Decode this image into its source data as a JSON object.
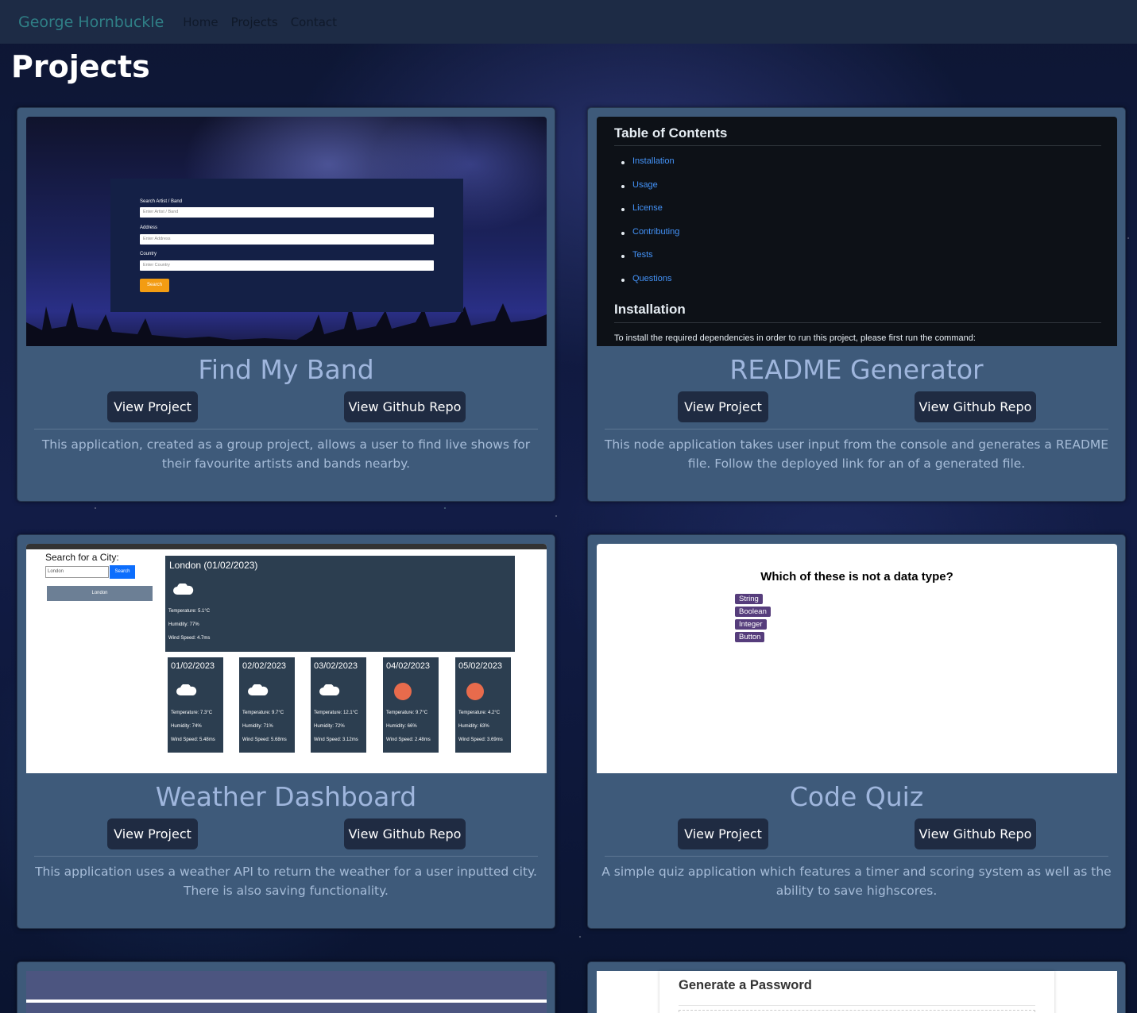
{
  "navbar": {
    "brand": "George Hornbuckle",
    "links": [
      "Home",
      "Projects",
      "Contact"
    ]
  },
  "page": {
    "title": "Projects"
  },
  "projects": [
    {
      "title": "Find My Band",
      "view_project": "View Project",
      "view_repo": "View Github Repo",
      "description": "This application, created as a group project, allows a user to find live shows for their favourite artists and bands nearby.",
      "preview": {
        "label_artist": "Search Artist / Band",
        "placeholder_artist": "Enter Artist / Band",
        "label_address": "Address",
        "placeholder_address": "Enter Address",
        "label_country": "Country",
        "placeholder_country": "Enter Country",
        "search_button": "Search"
      }
    },
    {
      "title": "README Generator",
      "view_project": "View Project",
      "view_repo": "View Github Repo",
      "description": "This node application takes user input from the console and generates a README file. Follow the deployed link for an of a generated file.",
      "preview": {
        "toc_heading": "Table of Contents",
        "toc_items": [
          "Installation",
          "Usage",
          "License",
          "Contributing",
          "Tests",
          "Questions"
        ],
        "install_heading": "Installation",
        "install_text": "To install the required dependencies in order to run this project, please first run the command:"
      }
    },
    {
      "title": "Weather Dashboard",
      "view_project": "View Project",
      "view_repo": "View Github Repo",
      "description": "This application uses a weather API to return the weather for a user inputted city. There is also saving functionality.",
      "preview": {
        "search_label": "Search for a City:",
        "input_value": "London",
        "search_button": "Search",
        "history_item": "London",
        "today_title": "London (01/02/2023)",
        "today_temp": "Temperature: 5.1°C",
        "today_humidity": "Humidity: 77%",
        "today_wind": "Wind Speed: 4.7ms",
        "forecast": [
          {
            "date": "01/02/2023",
            "icon": "cloud-icon",
            "temp": "Temperature: 7.3°C",
            "humidity": "Humidity: 74%",
            "wind": "Wind Speed: 5.48ms"
          },
          {
            "date": "02/02/2023",
            "icon": "cloud-icon",
            "temp": "Temperature: 9.7°C",
            "humidity": "Humidity: 71%",
            "wind": "Wind Speed: 5.68ms"
          },
          {
            "date": "03/02/2023",
            "icon": "cloud-icon",
            "temp": "Temperature: 12.1°C",
            "humidity": "Humidity: 72%",
            "wind": "Wind Speed: 3.12ms"
          },
          {
            "date": "04/02/2023",
            "icon": "sun-icon",
            "temp": "Temperature: 9.7°C",
            "humidity": "Humidity: 66%",
            "wind": "Wind Speed: 2.48ms"
          },
          {
            "date": "05/02/2023",
            "icon": "sun-icon",
            "temp": "Temperature: 4.2°C",
            "humidity": "Humidity: 63%",
            "wind": "Wind Speed: 3.69ms"
          }
        ]
      }
    },
    {
      "title": "Code Quiz",
      "view_project": "View Project",
      "view_repo": "View Github Repo",
      "description": "A simple quiz application which features a timer and scoring system as well as the ability to save highscores.",
      "preview": {
        "question": "Which of these is not a data type?",
        "options": [
          "String",
          "Boolean",
          "Integer",
          "Button"
        ]
      }
    }
  ],
  "partial_cards": {
    "password_title": "Generate a Password"
  },
  "colors": {
    "navbar": "#1d2b45",
    "card": "#3e5a7a",
    "button": "#1f2b42",
    "card_title": "#9fb6dd",
    "description": "#a6bcd8"
  }
}
